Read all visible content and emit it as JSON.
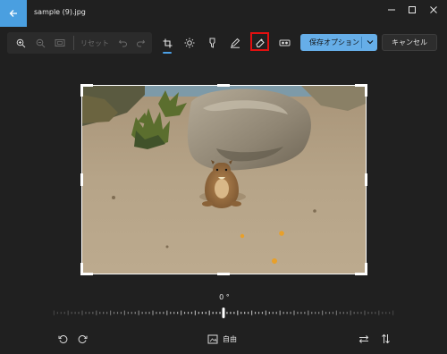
{
  "window": {
    "title": "sample (9).jpg"
  },
  "toolbar": {
    "zoom_in": "zoom-in-icon",
    "zoom_out": "zoom-out-icon",
    "actual_size": "fit-icon",
    "reset_label": "リセット",
    "undo": "undo-icon",
    "redo": "redo-icon",
    "tools": [
      "crop-icon",
      "adjust-brightness-icon",
      "filter-icon",
      "markup-icon",
      "erase-icon",
      "background-icon"
    ],
    "save_label": "保存オプション",
    "cancel_label": "キャンセル"
  },
  "editor": {
    "angle_label": "0 °",
    "aspect_label": "自由"
  },
  "colors": {
    "accent": "#66aee8",
    "back_button": "#4a9fe0",
    "highlight": "#e01010",
    "background": "#202020"
  }
}
